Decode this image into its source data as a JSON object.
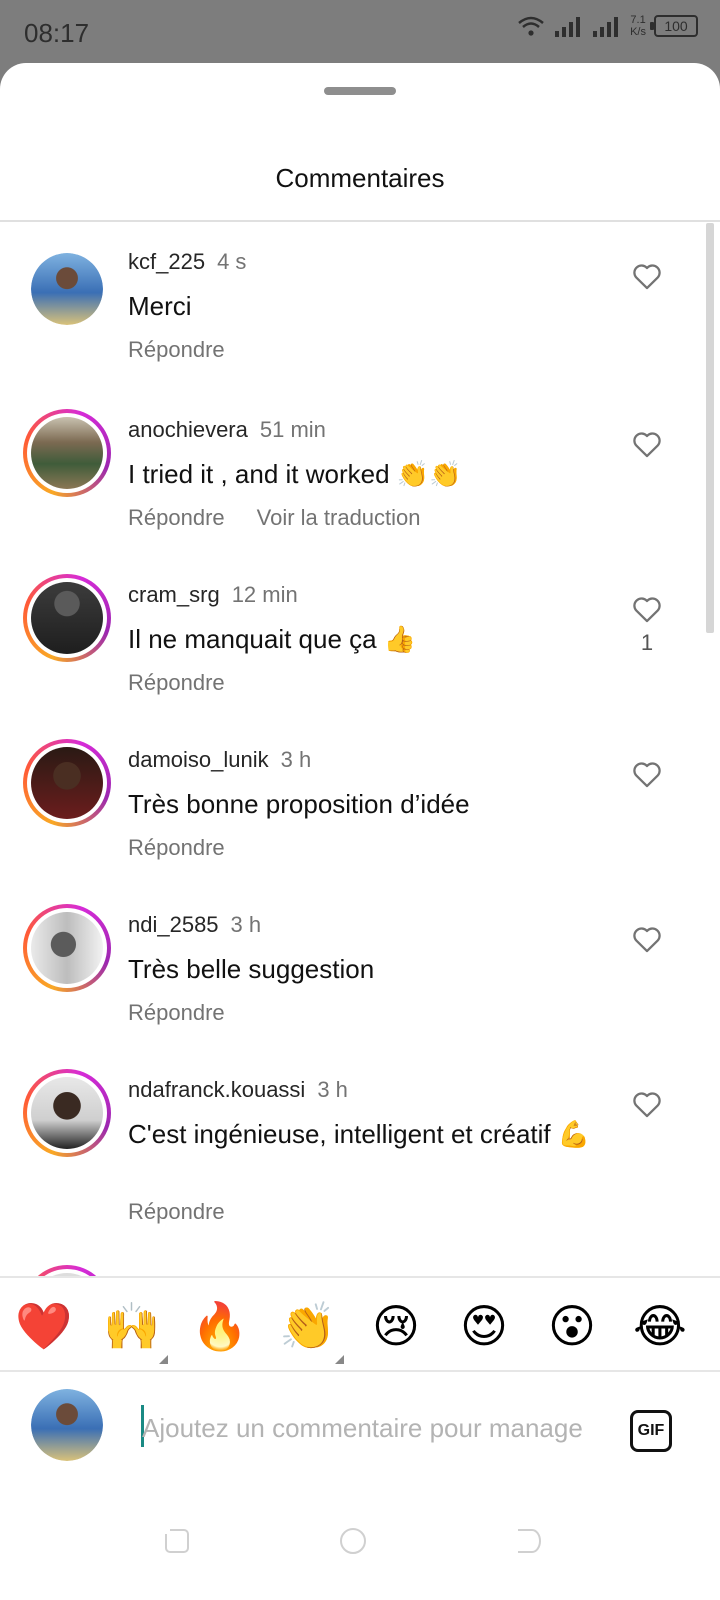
{
  "status_bar": {
    "time": "08:17",
    "net_speed_value": "7.1",
    "net_speed_unit": "K/s",
    "battery": "100"
  },
  "sheet": {
    "title": "Commentaires"
  },
  "comments": [
    {
      "username": "kcf_225",
      "time": "4 s",
      "text": "Merci",
      "reply": "Répondre",
      "translate": "",
      "likes": ""
    },
    {
      "username": "anochievera",
      "time": "51 min",
      "text": "I tried it , and it worked 👏👏",
      "reply": "Répondre",
      "translate": "Voir la traduction",
      "likes": ""
    },
    {
      "username": "cram_srg",
      "time": "12 min",
      "text": "Il ne manquait que ça 👍",
      "reply": "Répondre",
      "translate": "",
      "likes": "1"
    },
    {
      "username": "damoiso_lunik",
      "time": "3 h",
      "text": "Très bonne proposition d’idée",
      "reply": "Répondre",
      "translate": "",
      "likes": ""
    },
    {
      "username": "ndi_2585",
      "time": "3 h",
      "text": "Très belle suggestion",
      "reply": "Répondre",
      "translate": "",
      "likes": ""
    },
    {
      "username": "ndafranck.kouassi",
      "time": "3 h",
      "text": "C'est ingénieuse, intelligent et créatif 💪",
      "reply": "Répondre",
      "translate": "",
      "likes": ""
    }
  ],
  "emoji_bar": [
    "❤️",
    "🙌",
    "🔥",
    "👏",
    "😢",
    "😍",
    "😮",
    "😂"
  ],
  "composer": {
    "placeholder": "Ajoutez un commentaire pour manage",
    "gif_label": "GIF"
  },
  "icons": {
    "like": "heart-outline-icon",
    "nav_recent": "recent-apps-icon",
    "nav_home": "home-circle-icon",
    "nav_back": "back-icon"
  },
  "colors": {
    "story_ring": [
      "#f9a825",
      "#ff5a36",
      "#d62bd8"
    ],
    "caret": "#1a8a84"
  }
}
